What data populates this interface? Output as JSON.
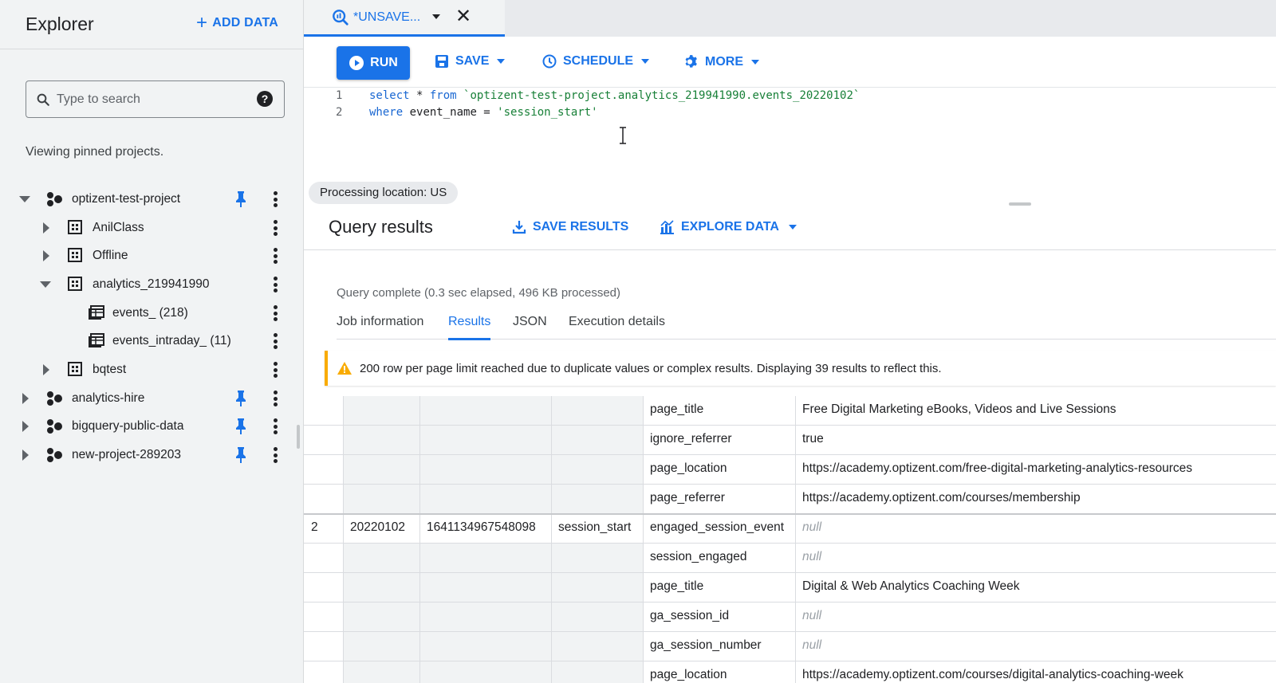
{
  "explorer": {
    "title": "Explorer",
    "add_data": "ADD DATA",
    "search_placeholder": "Type to search",
    "pinned_note": "Viewing pinned projects.",
    "tree": [
      {
        "label": "optizent-test-project",
        "kind": "project",
        "expanded": true,
        "pinned": true
      },
      {
        "label": "AnilClass",
        "kind": "dataset",
        "expanded": false
      },
      {
        "label": "Offline",
        "kind": "dataset",
        "expanded": false
      },
      {
        "label": "analytics_219941990",
        "kind": "dataset",
        "expanded": true
      },
      {
        "label": "events_ (218)",
        "kind": "table"
      },
      {
        "label": "events_intraday_ (11)",
        "kind": "table"
      },
      {
        "label": "bqtest",
        "kind": "dataset",
        "expanded": false
      },
      {
        "label": "analytics-hire",
        "kind": "project",
        "expanded": false,
        "pinned": true
      },
      {
        "label": "bigquery-public-data",
        "kind": "project",
        "expanded": false,
        "pinned": true
      },
      {
        "label": "new-project-289203",
        "kind": "project",
        "expanded": false,
        "pinned": true
      }
    ]
  },
  "editor_tab": {
    "label": "*UNSAVE..."
  },
  "toolbar": {
    "run": "RUN",
    "save": "SAVE",
    "schedule": "SCHEDULE",
    "more": "MORE"
  },
  "query": {
    "line1_num": "1",
    "line2_num": "2",
    "line1_kw1": "select",
    "line1_mid": " * ",
    "line1_kw2": "from",
    "line1_table": "`optizent-test-project.analytics_219941990.events_20220102`",
    "line2_kw": "where",
    "line2_mid": " event_name = ",
    "line2_str": "'session_start'"
  },
  "processing_location": "Processing location: US",
  "results": {
    "title": "Query results",
    "save_results": "SAVE RESULTS",
    "explore_data": "EXPLORE DATA",
    "status": "Query complete (0.3 sec elapsed, 496 KB processed)",
    "tabs": [
      "Job information",
      "Results",
      "JSON",
      "Execution details"
    ],
    "active_tab": "Results",
    "warning": "200 row per page limit reached due to duplicate values or complex results. Displaying 39 results to reflect this."
  },
  "grid_rows": [
    {
      "row": "",
      "event_date": "",
      "event_ts": "",
      "event_name": "",
      "key": "page_title",
      "value": "Free Digital Marketing eBooks, Videos and Live Sessions"
    },
    {
      "row": "",
      "event_date": "",
      "event_ts": "",
      "event_name": "",
      "key": "ignore_referrer",
      "value": "true"
    },
    {
      "row": "",
      "event_date": "",
      "event_ts": "",
      "event_name": "",
      "key": "page_location",
      "value": "https://academy.optizent.com/free-digital-marketing-analytics-resources"
    },
    {
      "row": "",
      "event_date": "",
      "event_ts": "",
      "event_name": "",
      "key": "page_referrer",
      "value": "https://academy.optizent.com/courses/membership"
    },
    {
      "row": "2",
      "event_date": "20220102",
      "event_ts": "1641134967548098",
      "event_name": "session_start",
      "key": "engaged_session_event",
      "value": "null"
    },
    {
      "row": "",
      "event_date": "",
      "event_ts": "",
      "event_name": "",
      "key": "session_engaged",
      "value": "null"
    },
    {
      "row": "",
      "event_date": "",
      "event_ts": "",
      "event_name": "",
      "key": "page_title",
      "value": "Digital & Web Analytics Coaching Week"
    },
    {
      "row": "",
      "event_date": "",
      "event_ts": "",
      "event_name": "",
      "key": "ga_session_id",
      "value": "null"
    },
    {
      "row": "",
      "event_date": "",
      "event_ts": "",
      "event_name": "",
      "key": "ga_session_number",
      "value": "null"
    },
    {
      "row": "",
      "event_date": "",
      "event_ts": "",
      "event_name": "",
      "key": "page_location",
      "value": "https://academy.optizent.com/courses/digital-analytics-coaching-week"
    }
  ],
  "colors": {
    "accent": "#1a73e8",
    "warning": "#f9ab00"
  }
}
